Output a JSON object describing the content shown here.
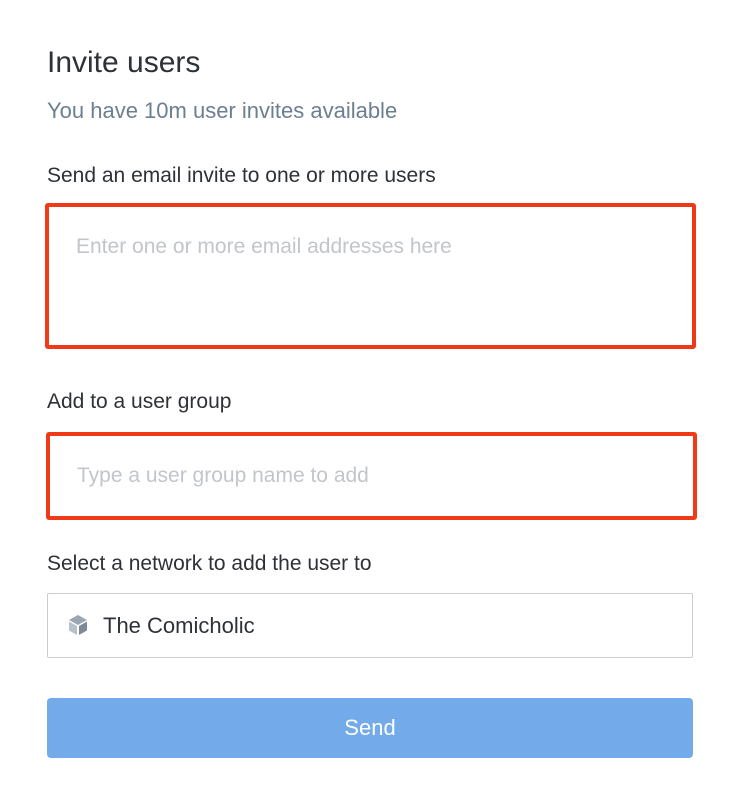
{
  "header": {
    "title": "Invite users",
    "subtitle": "You have 10m user invites available"
  },
  "email_section": {
    "label": "Send an email invite to one or more users",
    "value": "",
    "placeholder": "Enter one or more email addresses here"
  },
  "group_section": {
    "label": "Add to a user group",
    "value": "",
    "placeholder": "Type a user group name to add"
  },
  "network_section": {
    "label": "Select a network to add the user to",
    "selected": "The Comicholic",
    "icon": "network-cube-icon"
  },
  "actions": {
    "send_label": "Send"
  },
  "colors": {
    "highlight_border": "#f03a17",
    "subtitle": "#6b7f90",
    "send_button_bg": "#72aaea",
    "placeholder": "#c2c6ca"
  }
}
